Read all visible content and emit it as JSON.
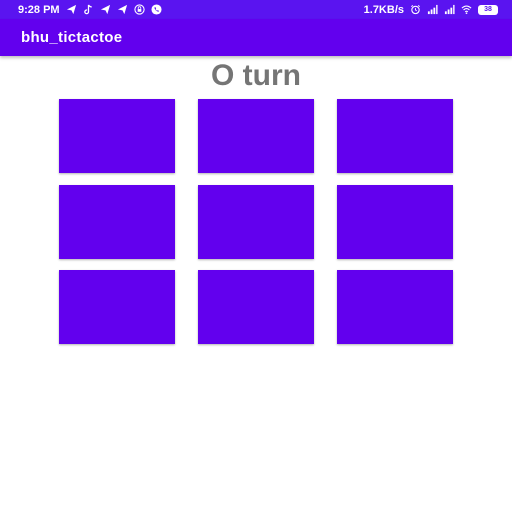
{
  "status_bar": {
    "time": "9:28 PM",
    "left_icons": [
      "telegram-icon",
      "tiktok-icon",
      "telegram-icon",
      "telegram-icon",
      "lock-icon",
      "phone-icon"
    ],
    "network_speed": "1.7KB/s",
    "right_icons": [
      "alarm-icon",
      "signal-icon",
      "signal-icon",
      "wifi-icon"
    ],
    "battery": "38"
  },
  "app_bar": {
    "title": "bhu_tictactoe"
  },
  "game": {
    "turn_text": "O turn",
    "board": [
      [
        "",
        "",
        ""
      ],
      [
        "",
        "",
        ""
      ],
      [
        "",
        "",
        ""
      ]
    ]
  },
  "colors": {
    "status_bar": "#5a14f0",
    "app_bar": "#6200ee",
    "cell": "#6200ee",
    "turn_text": "#757575",
    "background": "#ffffff"
  }
}
